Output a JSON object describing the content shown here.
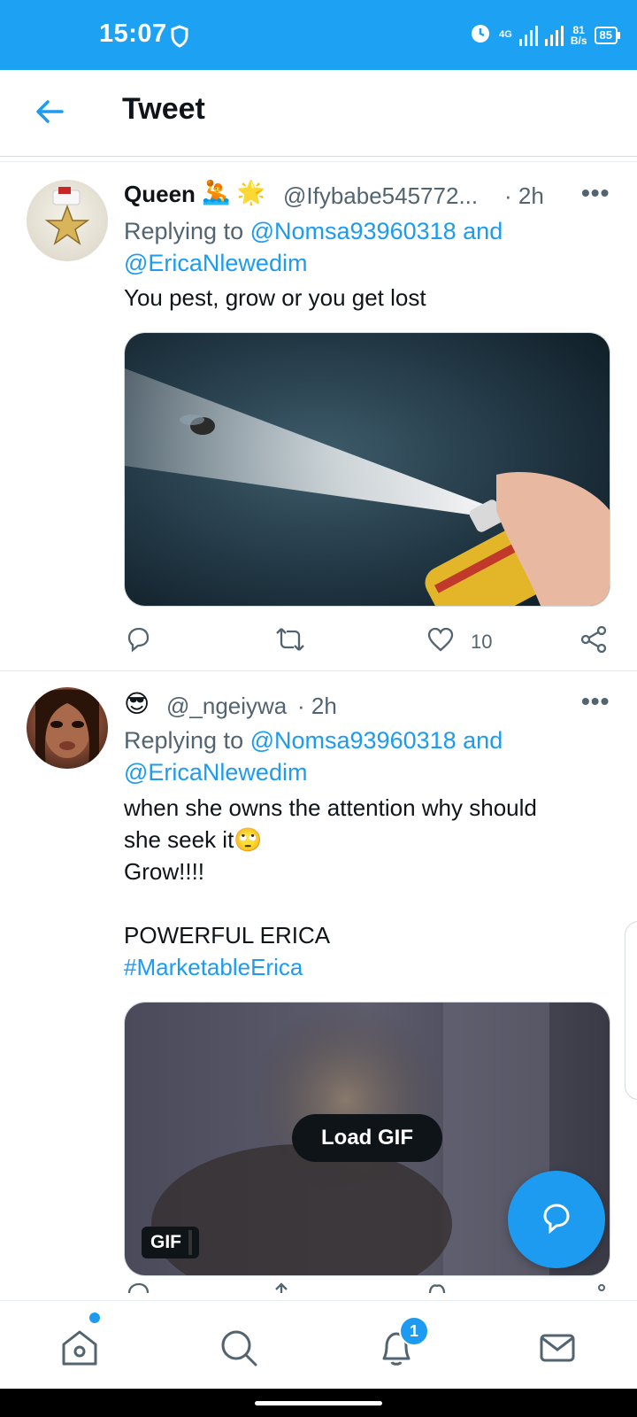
{
  "status_bar": {
    "time": "15:07",
    "network": "4G",
    "speed_value": "81",
    "speed_unit": "B/s",
    "battery": "85"
  },
  "header": {
    "title": "Tweet"
  },
  "tweets": [
    {
      "name": "Queen",
      "name_emojis": "🤽 🌟",
      "handle": "@Ifybabe545772...",
      "time": "· 2h",
      "reply_prefix": "Replying to ",
      "reply_to_1": "@Nomsa93960318",
      "reply_and": " and",
      "reply_to_2": "@EricaNlewedim",
      "text": "You pest, grow or you get lost",
      "like_count": "10"
    },
    {
      "name": "",
      "name_emojis": "😎",
      "handle": "@_ngeiywa",
      "time": "· 2h",
      "reply_prefix": "Replying to ",
      "reply_to_1": "@Nomsa93960318",
      "reply_and": " and",
      "reply_to_2": "@EricaNlewedim",
      "text_line1": "when she owns the attention why should",
      "text_line2": "she seek it🙄",
      "text_line3": "Grow!!!!",
      "text_line4": "POWERFUL ERICA",
      "hashtag": "#MarketableErica",
      "load_gif_label": "Load GIF",
      "gif_badge": "GIF"
    }
  ],
  "bottom_nav": {
    "notification_count": "1"
  },
  "colors": {
    "brand": "#1da1f2",
    "link": "#1d9bf0",
    "text": "#0f1419",
    "secondary": "#536471"
  }
}
